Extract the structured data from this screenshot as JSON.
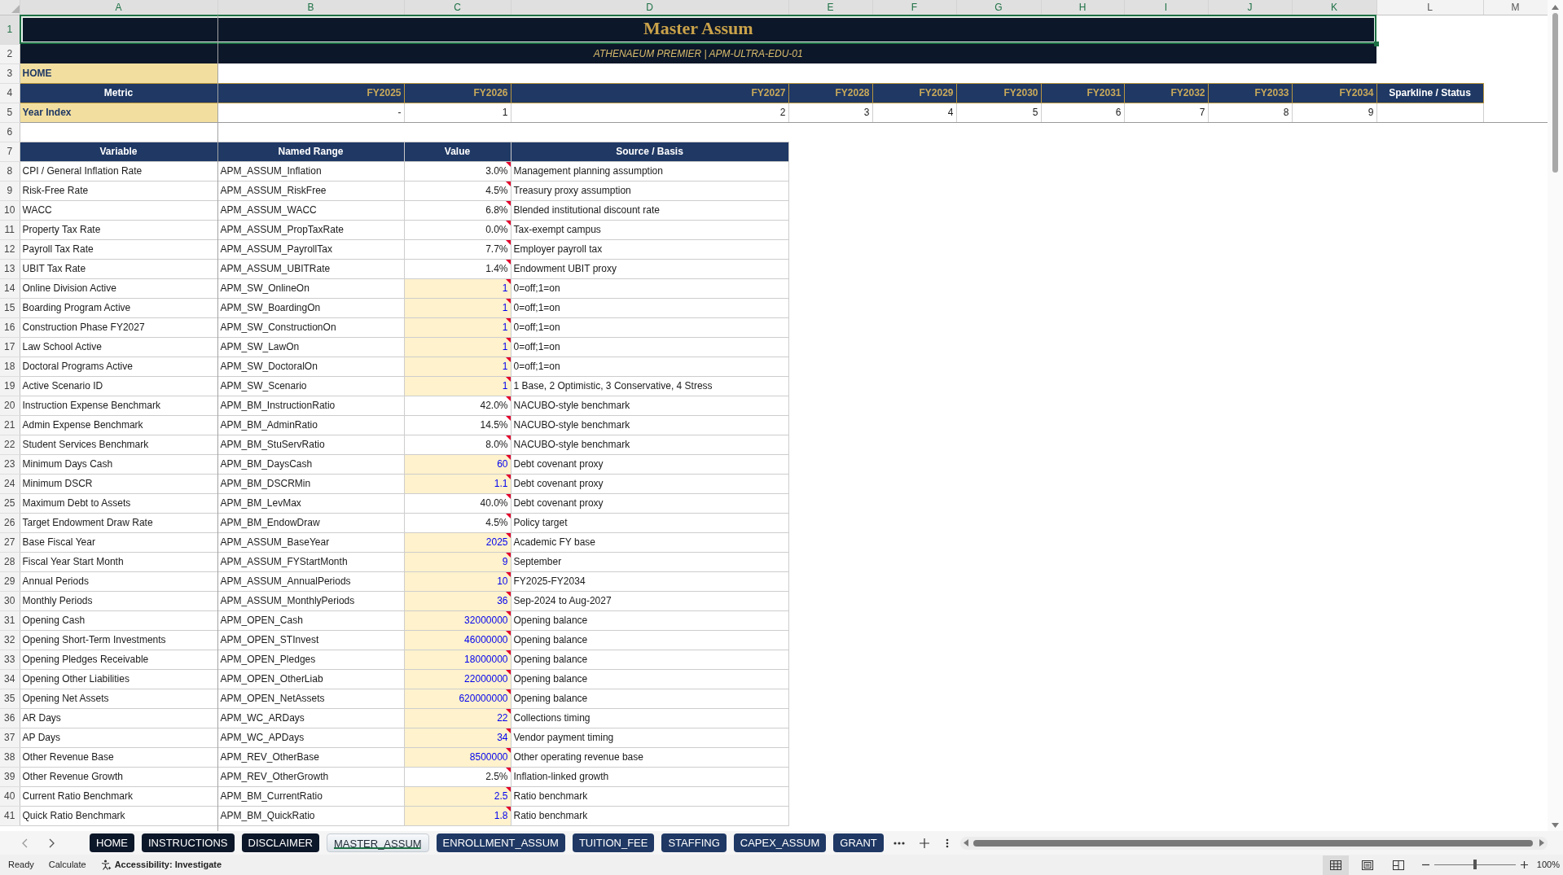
{
  "column_headers": [
    {
      "label": "A",
      "selected": true
    },
    {
      "label": "B",
      "selected": true
    },
    {
      "label": "C",
      "selected": true
    },
    {
      "label": "D",
      "selected": true
    },
    {
      "label": "E",
      "selected": true
    },
    {
      "label": "F",
      "selected": true
    },
    {
      "label": "G",
      "selected": true
    },
    {
      "label": "H",
      "selected": true
    },
    {
      "label": "I",
      "selected": true
    },
    {
      "label": "J",
      "selected": true
    },
    {
      "label": "K",
      "selected": true
    },
    {
      "label": "L",
      "selected": false
    },
    {
      "label": "M",
      "selected": false
    }
  ],
  "row_headers": [
    {
      "label": "1",
      "selected": true
    },
    {
      "label": "2",
      "selected": false
    },
    {
      "label": "3",
      "selected": false
    },
    {
      "label": "4",
      "selected": false
    },
    {
      "label": "5",
      "selected": false
    },
    {
      "label": "6",
      "selected": false
    },
    {
      "label": "7",
      "selected": false
    },
    {
      "label": "8",
      "selected": false
    },
    {
      "label": "9",
      "selected": false
    },
    {
      "label": "10",
      "selected": false
    },
    {
      "label": "11",
      "selected": false
    },
    {
      "label": "12",
      "selected": false
    },
    {
      "label": "13",
      "selected": false
    },
    {
      "label": "14",
      "selected": false
    },
    {
      "label": "15",
      "selected": false
    },
    {
      "label": "16",
      "selected": false
    },
    {
      "label": "17",
      "selected": false
    },
    {
      "label": "18",
      "selected": false
    },
    {
      "label": "19",
      "selected": false
    },
    {
      "label": "20",
      "selected": false
    },
    {
      "label": "21",
      "selected": false
    },
    {
      "label": "22",
      "selected": false
    },
    {
      "label": "23",
      "selected": false
    },
    {
      "label": "24",
      "selected": false
    },
    {
      "label": "25",
      "selected": false
    },
    {
      "label": "26",
      "selected": false
    },
    {
      "label": "27",
      "selected": false
    },
    {
      "label": "28",
      "selected": false
    },
    {
      "label": "29",
      "selected": false
    },
    {
      "label": "30",
      "selected": false
    },
    {
      "label": "31",
      "selected": false
    },
    {
      "label": "32",
      "selected": false
    },
    {
      "label": "33",
      "selected": false
    },
    {
      "label": "34",
      "selected": false
    },
    {
      "label": "35",
      "selected": false
    },
    {
      "label": "36",
      "selected": false
    },
    {
      "label": "37",
      "selected": false
    },
    {
      "label": "38",
      "selected": false
    },
    {
      "label": "39",
      "selected": false
    },
    {
      "label": "40",
      "selected": false
    },
    {
      "label": "41",
      "selected": false
    }
  ],
  "sheet": {
    "title": {
      "text": "Master Assum",
      "selected": true
    },
    "subtitle": "ATHENAEUM PREMIER | APM-ULTRA-EDU-01",
    "home_link": "HOME",
    "timeline": {
      "metric_header": "Metric",
      "years": [
        "FY2025",
        "FY2026",
        "FY2027",
        "FY2028",
        "FY2029",
        "FY2030",
        "FY2031",
        "FY2032",
        "FY2033",
        "FY2034"
      ],
      "status_header": "Sparkline / Status",
      "row_label": "Year Index",
      "year_index": [
        "-",
        "1",
        "2",
        "3",
        "4",
        "5",
        "6",
        "7",
        "8",
        "9"
      ]
    },
    "table": {
      "columns": [
        "Variable",
        "Named Range",
        "Value",
        "Source / Basis"
      ],
      "rows": [
        {
          "variable": "CPI / General Inflation Rate",
          "named_range": "APM_ASSUM_Inflation",
          "value": "3.0%",
          "source": "Management planning assumption",
          "input": false,
          "note": true
        },
        {
          "variable": "Risk-Free Rate",
          "named_range": "APM_ASSUM_RiskFree",
          "value": "4.5%",
          "source": "Treasury proxy assumption",
          "input": false,
          "note": true
        },
        {
          "variable": "WACC",
          "named_range": "APM_ASSUM_WACC",
          "value": "6.8%",
          "source": "Blended institutional discount rate",
          "input": false,
          "note": true
        },
        {
          "variable": "Property Tax Rate",
          "named_range": "APM_ASSUM_PropTaxRate",
          "value": "0.0%",
          "source": "Tax-exempt campus",
          "input": false,
          "note": true
        },
        {
          "variable": "Payroll Tax Rate",
          "named_range": "APM_ASSUM_PayrollTax",
          "value": "7.7%",
          "source": "Employer payroll tax",
          "input": false,
          "note": true
        },
        {
          "variable": "UBIT Tax Rate",
          "named_range": "APM_ASSUM_UBITRate",
          "value": "1.4%",
          "source": "Endowment UBIT proxy",
          "input": false,
          "note": true
        },
        {
          "variable": "Online Division Active",
          "named_range": "APM_SW_OnlineOn",
          "value": "1",
          "source": "0=off;1=on",
          "input": true,
          "note": true
        },
        {
          "variable": "Boarding Program Active",
          "named_range": "APM_SW_BoardingOn",
          "value": "1",
          "source": "0=off;1=on",
          "input": true,
          "note": true
        },
        {
          "variable": "Construction Phase FY2027",
          "named_range": "APM_SW_ConstructionOn",
          "value": "1",
          "source": "0=off;1=on",
          "input": true,
          "note": true
        },
        {
          "variable": "Law School Active",
          "named_range": "APM_SW_LawOn",
          "value": "1",
          "source": "0=off;1=on",
          "input": true,
          "note": true
        },
        {
          "variable": "Doctoral Programs Active",
          "named_range": "APM_SW_DoctoralOn",
          "value": "1",
          "source": "0=off;1=on",
          "input": true,
          "note": true
        },
        {
          "variable": "Active Scenario ID",
          "named_range": "APM_SW_Scenario",
          "value": "1",
          "source": "1 Base, 2 Optimistic, 3 Conservative, 4 Stress",
          "input": true,
          "note": true
        },
        {
          "variable": "Instruction Expense Benchmark",
          "named_range": "APM_BM_InstructionRatio",
          "value": "42.0%",
          "source": "NACUBO-style benchmark",
          "input": false,
          "note": true
        },
        {
          "variable": "Admin Expense Benchmark",
          "named_range": "APM_BM_AdminRatio",
          "value": "14.5%",
          "source": "NACUBO-style benchmark",
          "input": false,
          "note": true
        },
        {
          "variable": "Student Services Benchmark",
          "named_range": "APM_BM_StuServRatio",
          "value": "8.0%",
          "source": "NACUBO-style benchmark",
          "input": false,
          "note": true
        },
        {
          "variable": "Minimum Days Cash",
          "named_range": "APM_BM_DaysCash",
          "value": "60",
          "source": "Debt covenant proxy",
          "input": true,
          "note": true
        },
        {
          "variable": "Minimum DSCR",
          "named_range": "APM_BM_DSCRMin",
          "value": "1.1",
          "source": "Debt covenant proxy",
          "input": true,
          "note": true
        },
        {
          "variable": "Maximum Debt to Assets",
          "named_range": "APM_BM_LevMax",
          "value": "40.0%",
          "source": "Debt covenant proxy",
          "input": false,
          "note": true
        },
        {
          "variable": "Target Endowment Draw Rate",
          "named_range": "APM_BM_EndowDraw",
          "value": "4.5%",
          "source": "Policy target",
          "input": false,
          "note": true
        },
        {
          "variable": "Base Fiscal Year",
          "named_range": "APM_ASSUM_BaseYear",
          "value": "2025",
          "source": "Academic FY base",
          "input": true,
          "note": true
        },
        {
          "variable": "Fiscal Year Start Month",
          "named_range": "APM_ASSUM_FYStartMonth",
          "value": "9",
          "source": "September",
          "input": true,
          "note": true
        },
        {
          "variable": "Annual Periods",
          "named_range": "APM_ASSUM_AnnualPeriods",
          "value": "10",
          "source": "FY2025-FY2034",
          "input": true,
          "note": true
        },
        {
          "variable": "Monthly Periods",
          "named_range": "APM_ASSUM_MonthlyPeriods",
          "value": "36",
          "source": "Sep-2024 to Aug-2027",
          "input": true,
          "note": true
        },
        {
          "variable": "Opening Cash",
          "named_range": "APM_OPEN_Cash",
          "value": "32000000",
          "source": "Opening balance",
          "input": true,
          "note": true
        },
        {
          "variable": "Opening Short-Term Investments",
          "named_range": "APM_OPEN_STInvest",
          "value": "46000000",
          "source": "Opening balance",
          "input": true,
          "note": true
        },
        {
          "variable": "Opening Pledges Receivable",
          "named_range": "APM_OPEN_Pledges",
          "value": "18000000",
          "source": "Opening balance",
          "input": true,
          "note": true
        },
        {
          "variable": "Opening Other Liabilities",
          "named_range": "APM_OPEN_OtherLiab",
          "value": "22000000",
          "source": "Opening balance",
          "input": true,
          "note": true
        },
        {
          "variable": "Opening Net Assets",
          "named_range": "APM_OPEN_NetAssets",
          "value": "620000000",
          "source": "Opening balance",
          "input": true,
          "note": true
        },
        {
          "variable": "AR Days",
          "named_range": "APM_WC_ARDays",
          "value": "22",
          "source": "Collections timing",
          "input": true,
          "note": true
        },
        {
          "variable": "AP Days",
          "named_range": "APM_WC_APDays",
          "value": "34",
          "source": "Vendor payment timing",
          "input": true,
          "note": true
        },
        {
          "variable": "Other Revenue Base",
          "named_range": "APM_REV_OtherBase",
          "value": "8500000",
          "source": "Other operating revenue base",
          "input": true,
          "note": true
        },
        {
          "variable": "Other Revenue Growth",
          "named_range": "APM_REV_OtherGrowth",
          "value": "2.5%",
          "source": "Inflation-linked growth",
          "input": false,
          "note": true
        },
        {
          "variable": "Current Ratio Benchmark",
          "named_range": "APM_BM_CurrentRatio",
          "value": "2.5",
          "source": "Ratio benchmark",
          "input": true,
          "note": true
        },
        {
          "variable": "Quick Ratio Benchmark",
          "named_range": "APM_BM_QuickRatio",
          "value": "1.8",
          "source": "Ratio benchmark",
          "input": true,
          "note": true
        }
      ]
    }
  },
  "sheet_tabs": [
    {
      "label": "HOME",
      "color": "#0c1729",
      "selected": false
    },
    {
      "label": "INSTRUCTIONS",
      "color": "#0c1729",
      "selected": false
    },
    {
      "label": "DISCLAIMER",
      "color": "#0c1729",
      "selected": false
    },
    {
      "label": "MASTER_ASSUM",
      "selected": true
    },
    {
      "label": "ENROLLMENT_ASSUM",
      "color": "#1f3864",
      "selected": false
    },
    {
      "label": "TUITION_FEE",
      "color": "#1f3864",
      "selected": false
    },
    {
      "label": "STAFFING",
      "color": "#1f3864",
      "selected": false
    },
    {
      "label": "CAPEX_ASSUM",
      "color": "#1f3864",
      "selected": false
    },
    {
      "label": "GRANT",
      "color": "#1f3864",
      "selected": false
    }
  ],
  "status_bar": {
    "mode": "Ready",
    "calculate": "Calculate",
    "accessibility": "Accessibility: Investigate",
    "views": [
      {
        "kind": "normal",
        "selected": true
      },
      {
        "kind": "page_layout",
        "selected": false
      },
      {
        "kind": "page_break",
        "selected": false
      }
    ],
    "zoom": {
      "level": 0.5,
      "reading": "100%"
    }
  }
}
